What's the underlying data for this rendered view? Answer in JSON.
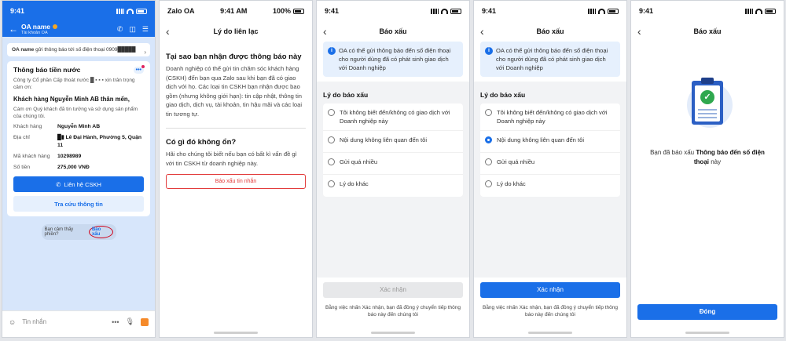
{
  "colors": {
    "accent": "#1a6fe8",
    "danger": "#e23b3b",
    "info_bg": "#e6f0fd"
  },
  "screen1": {
    "status": {
      "time": "9:41"
    },
    "header": {
      "oa_name": "OA name",
      "oa_sub": "Tài khoản OA"
    },
    "notice": {
      "bold": "OA name",
      "text": " gửi thông báo tới số điện thoại 0909█████"
    },
    "card": {
      "title": "Thông báo tiền nước",
      "intro": "Công ty Cổ phần Cấp thoát nước  █ ▪ ▪ ▪ xin trân trọng cảm ơn:",
      "greeting": "Khách hàng Nguyễn Minh AB  thân mến,",
      "thanks": "Cám ơn Quý khách đã tin tưởng và sử dụng sản phẩm của chúng tôi.",
      "rows": [
        {
          "k": "Khách hàng",
          "v": "Nguyễn Minh AB"
        },
        {
          "k": "Địa chỉ",
          "v": "█▮ Lê Đại Hành, Phường 5, Quận 11"
        },
        {
          "k": "Mã khách hàng",
          "v": "10298989"
        },
        {
          "k": "Số tiền",
          "v": "275,000 VNĐ"
        }
      ],
      "btn_contact": "Liên hệ CSKH",
      "btn_lookup": "Tra cứu thông tin"
    },
    "report_prompt": "Bạn cảm thấy phiền?",
    "report_link": "Báo xấu",
    "input_placeholder": "Tin nhắn",
    "input_more": "•••"
  },
  "screen2": {
    "status": {
      "carrier": "Zalo OA",
      "time": "9:41 AM",
      "battery": "100%"
    },
    "title": "Lý do liên lạc",
    "h1": "Tại sao bạn nhận được thông báo này",
    "p1": "Doanh nghiệp có thể gửi tin chăm sóc khách hàng (CSKH) đến bạn qua Zalo sau khi bạn đã có giao dịch với họ. Các loại tin CSKH bạn nhận được bao gồm (nhưng không giới hạn): tin cập nhật, thông tin giao dịch, dịch vụ, tài khoản, tin hậu mãi và các loại tin tương tự.",
    "h2": "Có gì đó không ổn?",
    "p2": "Hãi cho chúng tôi biết nếu bạn có bất kì vấn đề gì với tin CSKH từ doanh nghiệp này.",
    "report_btn": "Báo xấu tin nhắn"
  },
  "screen3": {
    "status": {
      "time": "9:41"
    },
    "title": "Báo xấu",
    "info": "OA có thể gửi thông báo đến số điện thoại cho người dùng đã có phát sinh giao dịch với Doanh nghiệp",
    "section": "Lý do báo xấu",
    "options": [
      "Tôi không biết đến/không có giao dịch với Doanh nghiệp này",
      "Nội dung không liên quan đến tôi",
      "Gửi quá nhiều",
      "Lý do khác"
    ],
    "selected": null,
    "confirm": "Xác nhận",
    "footnote": "Bằng việc nhấn Xác nhận, bạn đã đồng ý chuyển tiếp thông báo này đến chúng tôi"
  },
  "screen4": {
    "status": {
      "time": "9:41"
    },
    "title": "Báo xấu",
    "info": "OA có thể gửi thông báo đến số điện thoại cho người dùng đã có phát sinh giao dịch với Doanh nghiệp",
    "section": "Lý do báo xấu",
    "options": [
      "Tôi không biết đến/không có giao dịch với Doanh nghiệp này",
      "Nội dung không liên quan đến tôi",
      "Gửi quá nhiều",
      "Lý do khác"
    ],
    "selected": 1,
    "confirm": "Xác nhận",
    "footnote": "Bằng việc nhấn Xác nhận, bạn đã đồng ý chuyển tiếp thông báo này đến chúng tôi"
  },
  "screen5": {
    "status": {
      "time": "9:41"
    },
    "title": "Báo xấu",
    "msg_pre": "Bạn đã báo xấu ",
    "msg_bold": "Thông báo đến số điện thoại",
    "msg_post": " này",
    "close": "Đóng"
  }
}
